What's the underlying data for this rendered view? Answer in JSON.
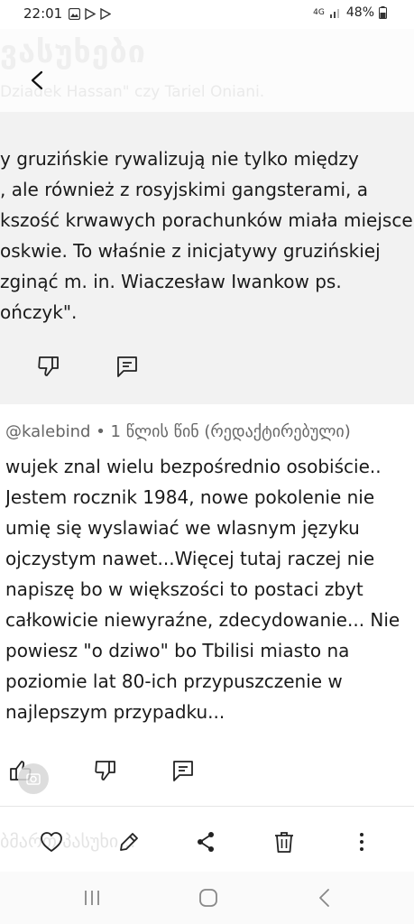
{
  "status": {
    "time": "22:01",
    "network": "4G",
    "battery": "48%"
  },
  "header": {
    "ghost_title": "ვასუხები",
    "ghost_subtitle": "Dziadek Hassan\" czy Tariel Oniani."
  },
  "comment1": {
    "lines": [
      "y gruzińskie rywalizują nie tylko między",
      ", ale również z rosyjskimi gangsterami, a",
      "kszość krwawych porachunków miała miejsce",
      "oskwie. To właśnie z inicjatywy gruzińskiej",
      "zginąć m. in. Wiaczesław Iwankow ps.",
      "ończyk\"."
    ]
  },
  "comment2": {
    "meta": "@kalebind • 1 წლის წინ (რედაქტირებული)",
    "lines": [
      "wujek  znal wielu  bezpośrednio osobiście..",
      "Jestem rocznik 1984, nowe pokolenie nie",
      "umię  się wyslawiać  we wlasnym języku",
      "ojczystym nawet...Więcej tutaj raczej nie",
      "napiszę bo w większości to postaci zbyt",
      "całkowicie niewyraźne, zdecydowanie... Nie",
      "powiesz \"o dziwo\" bo Tbilisi miasto na",
      "poziomie lat 80-ich  przypuszczenie w",
      "najlepszym przypadku..."
    ]
  },
  "footer": {
    "ghost_text": "ბმართ პასუხი..."
  },
  "icons": {
    "back": "chevron-left-icon",
    "dislike": "thumbs-down-icon",
    "reply": "comment-icon",
    "like": "thumbs-up-icon",
    "heart": "heart-icon",
    "edit": "pencil-icon",
    "share": "share-icon",
    "delete": "trash-icon",
    "more": "more-vertical-icon"
  }
}
